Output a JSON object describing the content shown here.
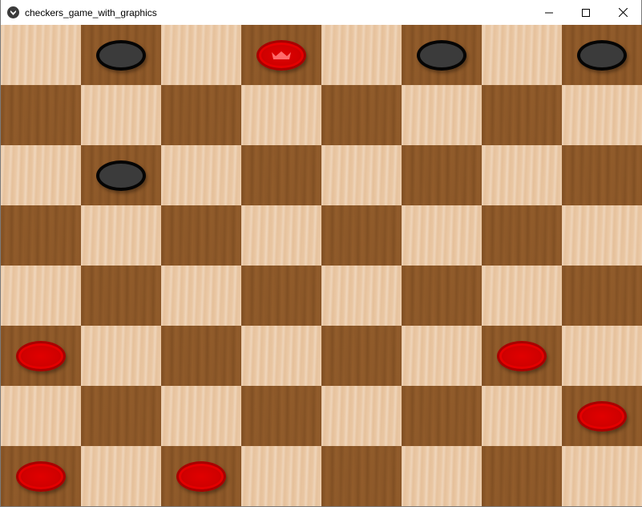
{
  "window": {
    "title": "checkers_game_with_graphics",
    "minimize_label": "minimize",
    "maximize_label": "maximize",
    "close_label": "close"
  },
  "board": {
    "rows": 8,
    "cols": 8,
    "light_color": "#ebc9a6",
    "dark_color": "#8f5a2a",
    "top_left": "light"
  },
  "pieces": [
    {
      "row": 0,
      "col": 1,
      "color": "black",
      "king": false
    },
    {
      "row": 0,
      "col": 3,
      "color": "red",
      "king": true
    },
    {
      "row": 0,
      "col": 5,
      "color": "black",
      "king": false
    },
    {
      "row": 0,
      "col": 7,
      "color": "black",
      "king": false
    },
    {
      "row": 2,
      "col": 1,
      "color": "black",
      "king": false
    },
    {
      "row": 5,
      "col": 0,
      "color": "red",
      "king": false
    },
    {
      "row": 5,
      "col": 6,
      "color": "red",
      "king": false
    },
    {
      "row": 6,
      "col": 7,
      "color": "red",
      "king": false
    },
    {
      "row": 7,
      "col": 0,
      "color": "red",
      "king": false
    },
    {
      "row": 7,
      "col": 2,
      "color": "red",
      "king": false
    }
  ],
  "colors": {
    "black_piece": "#3b3b3b",
    "red_piece": "#d00000",
    "crown": "#ff6a6a"
  },
  "icons": {
    "app": "app-icon",
    "crown": "crown-icon"
  }
}
